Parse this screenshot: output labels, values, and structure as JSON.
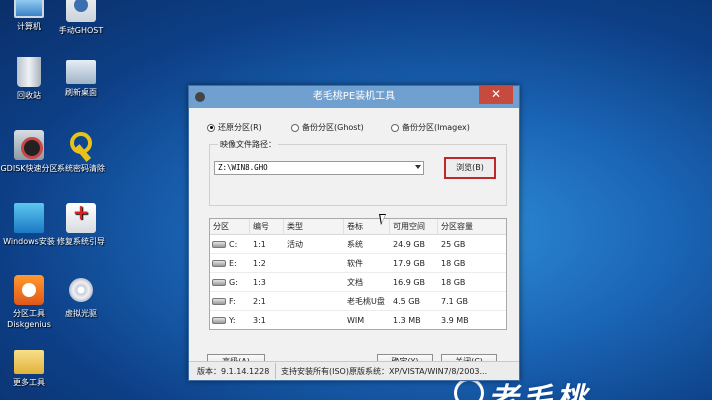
{
  "desktop": {
    "icons": [
      {
        "label": "计算机",
        "icon": "computer-icon"
      },
      {
        "label": "手动GHOST",
        "icon": "ghost-icon"
      },
      {
        "label": "回收站",
        "icon": "recycle-bin-icon"
      },
      {
        "label": "刷新桌面",
        "icon": "refresh-desktop-icon"
      },
      {
        "label": "GDISK快速分区",
        "icon": "gdisk-icon"
      },
      {
        "label": "系统密码清除",
        "icon": "key-icon"
      },
      {
        "label": "Windows安装",
        "icon": "windows-install-icon"
      },
      {
        "label": "修复系统引导",
        "icon": "repair-icon"
      },
      {
        "label": "分区工具\nDiskgenius",
        "icon": "diskgenius-icon"
      },
      {
        "label": "虚拟光驱",
        "icon": "virtual-cd-icon"
      },
      {
        "label": "更多工具",
        "icon": "folder-icon"
      }
    ]
  },
  "window": {
    "title": "老毛桃PE装机工具",
    "close_glyph": "✕",
    "modes": [
      {
        "label": "还原分区(R)",
        "selected": true
      },
      {
        "label": "备份分区(Ghost)",
        "selected": false
      },
      {
        "label": "备份分区(Imagex)",
        "selected": false
      }
    ],
    "image_path": {
      "label": "映像文件路径：",
      "value": "Z:\\WIN8.GHO",
      "browse_label": "浏览(B)"
    },
    "table": {
      "headers": [
        "分区",
        "编号",
        "类型",
        "卷标",
        "可用空间",
        "分区容量"
      ],
      "rows": [
        {
          "drive": "C:",
          "num": "1:1",
          "type": "活动",
          "label": "系统",
          "free": "24.9 GB",
          "size": "25 GB"
        },
        {
          "drive": "E:",
          "num": "1:2",
          "type": "",
          "label": "软件",
          "free": "17.9 GB",
          "size": "18 GB"
        },
        {
          "drive": "G:",
          "num": "1:3",
          "type": "",
          "label": "文档",
          "free": "16.9 GB",
          "size": "18 GB"
        },
        {
          "drive": "F:",
          "num": "2:1",
          "type": "",
          "label": "老毛桃U盘",
          "free": "4.5 GB",
          "size": "7.1 GB"
        },
        {
          "drive": "Y:",
          "num": "3:1",
          "type": "",
          "label": "WIM",
          "free": "1.3 MB",
          "size": "3.9 MB"
        }
      ]
    },
    "buttons": {
      "advanced": "高级(A)",
      "ok": "确定(Y)",
      "close": "关闭(C)"
    },
    "status": {
      "version": "版本：9.1.14.1228",
      "support": "支持安装所有(ISO)原版系统：XP/VISTA/WIN7/8/2003..."
    }
  },
  "watermark": "老毛桃",
  "colors": {
    "titlebar": "#6fa0cf",
    "close_button": "#c74a3e",
    "browse_highlight": "#c0262a",
    "desktop": "#1a64b4"
  }
}
